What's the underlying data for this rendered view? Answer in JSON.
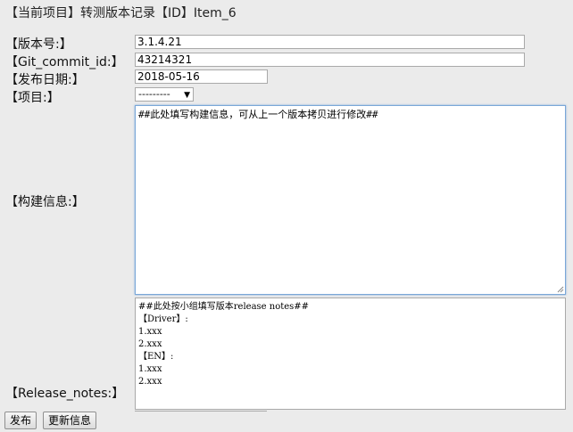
{
  "header": {
    "title": "【当前项目】转测版本记录【ID】Item_6"
  },
  "form": {
    "version": {
      "label": "【版本号:】",
      "value": "3.1.4.21"
    },
    "git_commit": {
      "label": "【Git_commit_id:】",
      "value": "43214321"
    },
    "release_date": {
      "label": "【发布日期:】",
      "value": "2018-05-16"
    },
    "project": {
      "label": "【项目:】",
      "selected": "---------"
    },
    "build_info": {
      "label": "【构建信息:】",
      "lines": [
        "##此处填写构建信息，可从上一个版本拷贝进行修改##"
      ]
    },
    "release_notes": {
      "label": "【Release_notes:】",
      "lines": [
        "##此处按小组填写版本release notes##",
        "【Driver】:",
        "1.xxx",
        "2.xxx",
        "【EN】:",
        "1.xxx",
        "2.xxx"
      ]
    }
  },
  "buttons": {
    "publish": "发布",
    "update": "更新信息"
  }
}
